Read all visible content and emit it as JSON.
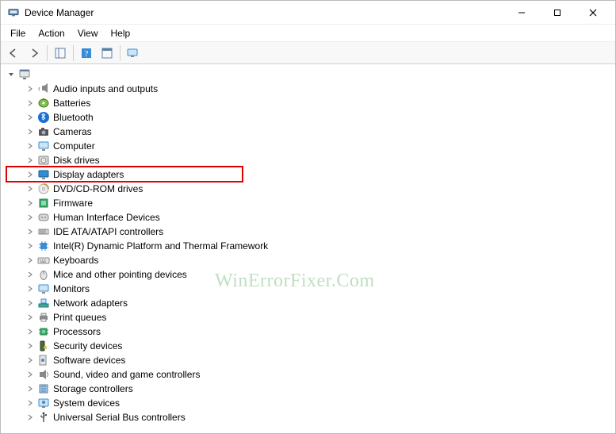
{
  "window": {
    "title": "Device Manager"
  },
  "menu": {
    "items": [
      "File",
      "Action",
      "View",
      "Help"
    ]
  },
  "toolbar": {
    "buttons": [
      {
        "name": "back",
        "icon": "arrow-left"
      },
      {
        "name": "forward",
        "icon": "arrow-right"
      },
      {
        "name": "sep"
      },
      {
        "name": "show-hide-tree",
        "icon": "tree"
      },
      {
        "name": "sep"
      },
      {
        "name": "help",
        "icon": "help"
      },
      {
        "name": "properties",
        "icon": "props"
      },
      {
        "name": "sep"
      },
      {
        "name": "scan-hardware",
        "icon": "monitor"
      }
    ]
  },
  "tree": {
    "root_icon": "computer",
    "root_expanded": true,
    "categories": [
      {
        "label": "Audio inputs and outputs",
        "icon": "audio"
      },
      {
        "label": "Batteries",
        "icon": "battery"
      },
      {
        "label": "Bluetooth",
        "icon": "bluetooth"
      },
      {
        "label": "Cameras",
        "icon": "camera"
      },
      {
        "label": "Computer",
        "icon": "monitor"
      },
      {
        "label": "Disk drives",
        "icon": "disk"
      },
      {
        "label": "Display adapters",
        "icon": "display",
        "highlighted": true
      },
      {
        "label": "DVD/CD-ROM drives",
        "icon": "cd"
      },
      {
        "label": "Firmware",
        "icon": "firmware"
      },
      {
        "label": "Human Interface Devices",
        "icon": "hid"
      },
      {
        "label": "IDE ATA/ATAPI controllers",
        "icon": "ide"
      },
      {
        "label": "Intel(R) Dynamic Platform and Thermal Framework",
        "icon": "chip"
      },
      {
        "label": "Keyboards",
        "icon": "keyboard"
      },
      {
        "label": "Mice and other pointing devices",
        "icon": "mouse"
      },
      {
        "label": "Monitors",
        "icon": "monitor"
      },
      {
        "label": "Network adapters",
        "icon": "network"
      },
      {
        "label": "Print queues",
        "icon": "printer"
      },
      {
        "label": "Processors",
        "icon": "cpu"
      },
      {
        "label": "Security devices",
        "icon": "security"
      },
      {
        "label": "Software devices",
        "icon": "software"
      },
      {
        "label": "Sound, video and game controllers",
        "icon": "sound"
      },
      {
        "label": "Storage controllers",
        "icon": "storage"
      },
      {
        "label": "System devices",
        "icon": "system"
      },
      {
        "label": "Universal Serial Bus controllers",
        "icon": "usb"
      }
    ]
  },
  "watermark": "WinErrorFixer.Com"
}
